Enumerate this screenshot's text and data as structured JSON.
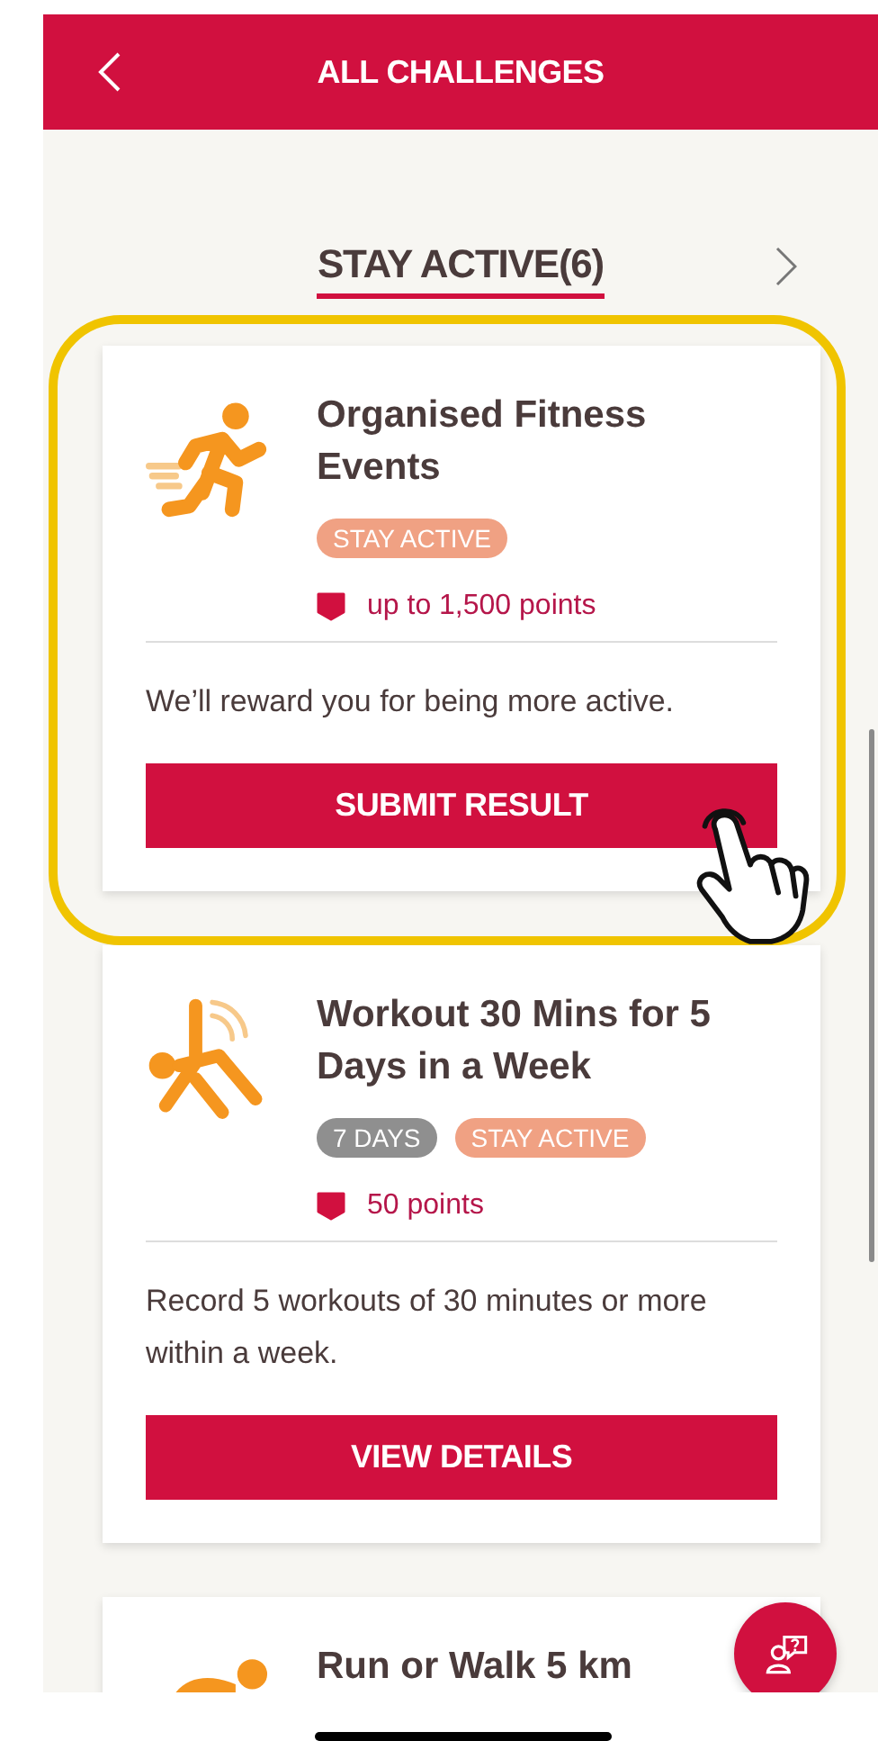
{
  "header": {
    "title": "ALL CHALLENGES"
  },
  "category": {
    "label": "STAY ACTIVE(6)",
    "selected": true
  },
  "challenges": [
    {
      "kind": "runner",
      "title": "Organised Fitness Events",
      "tags": [
        {
          "label": "STAY ACTIVE",
          "kind": "category"
        }
      ],
      "points": "up to 1,500 points",
      "description": "We’ll reward you for being more active.",
      "button": "SUBMIT RESULT",
      "highlighted": true
    },
    {
      "kind": "stretch",
      "title": "Workout 30 Mins for 5 Days in a Week",
      "tags": [
        {
          "label": "7 DAYS",
          "kind": "duration"
        },
        {
          "label": "STAY ACTIVE",
          "kind": "category"
        }
      ],
      "points": "50 points",
      "description": "Record 5 workouts of 30 minutes or more within a week.",
      "button": "VIEW DETAILS",
      "highlighted": false
    },
    {
      "kind": "walker",
      "title": "Run or Walk 5 km",
      "highlighted": false
    }
  ]
}
